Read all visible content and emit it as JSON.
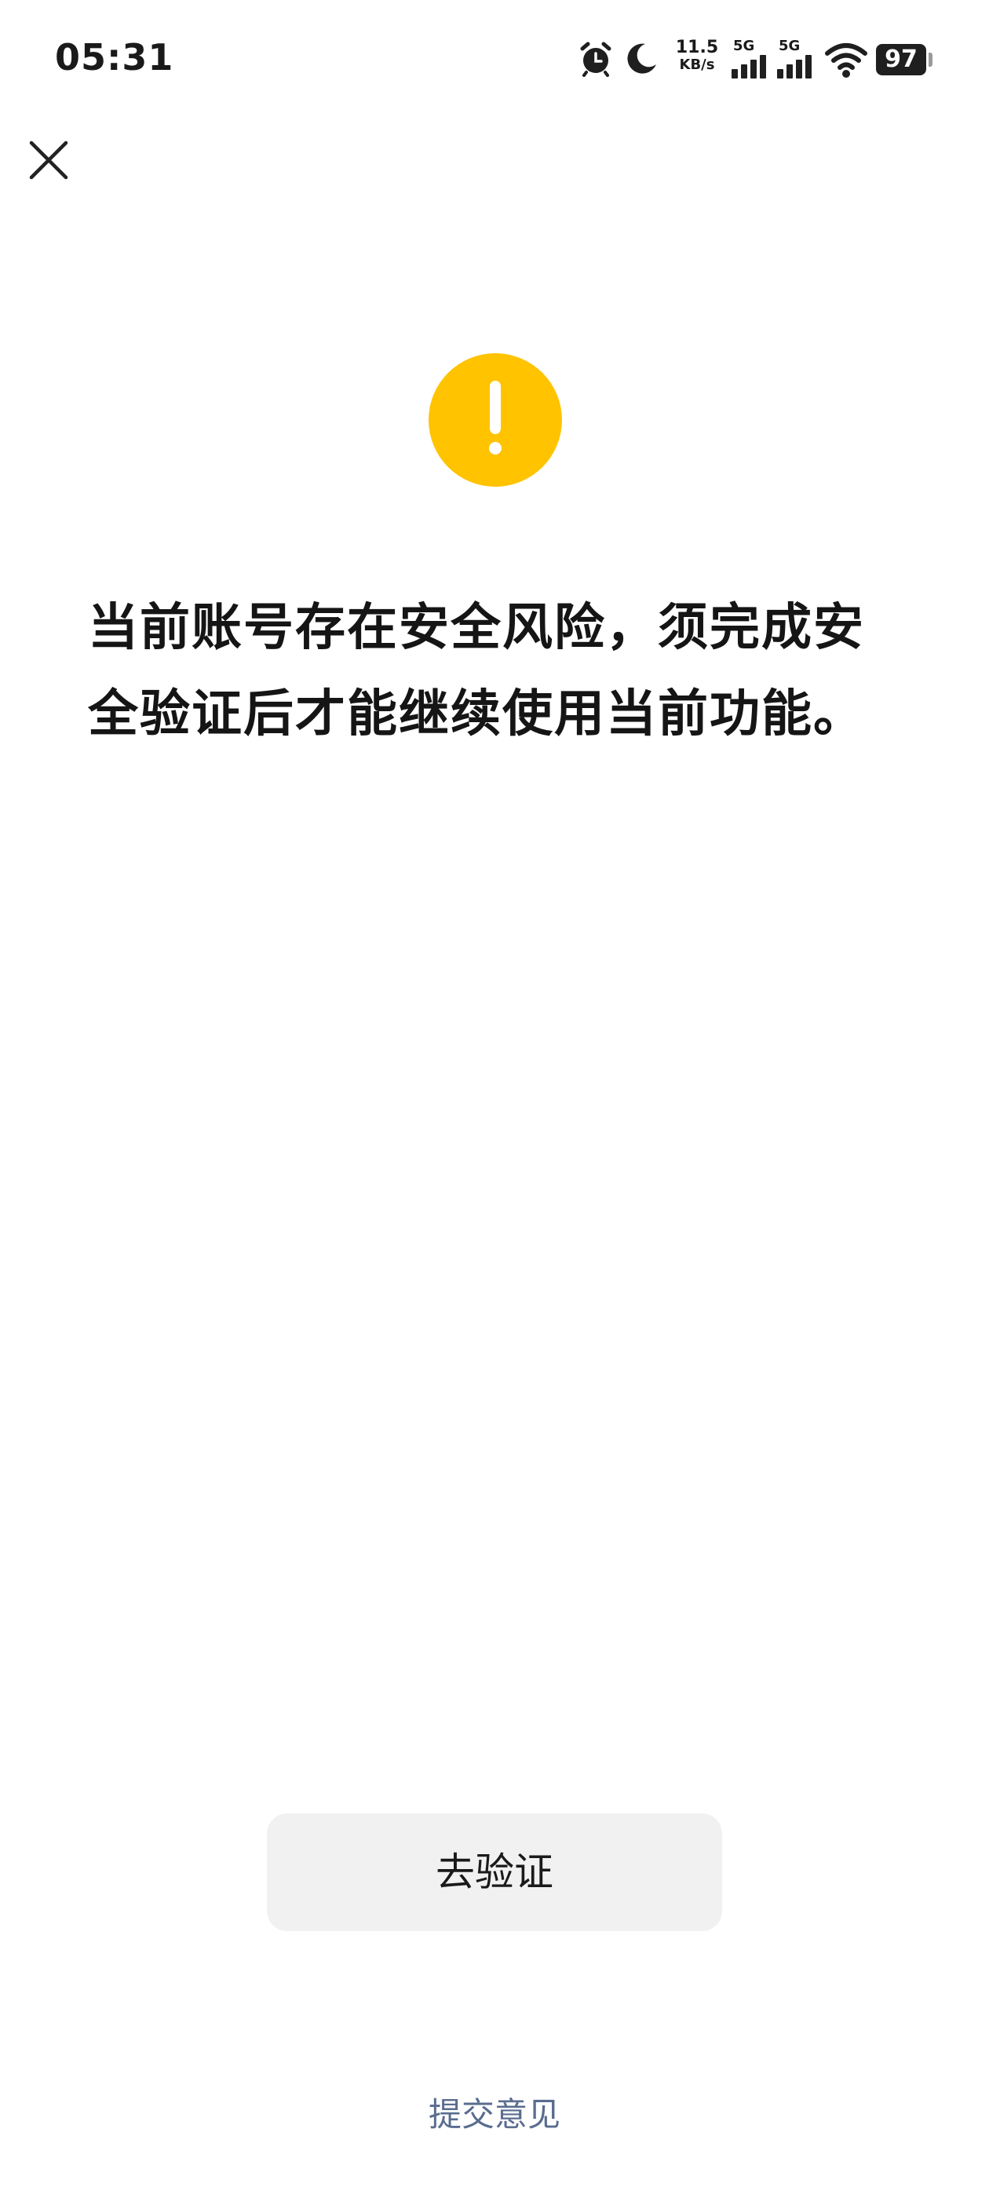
{
  "status_bar": {
    "time": "05:31",
    "net_speed_value": "11.5",
    "net_speed_unit": "KB/s",
    "sim1_label": "5G",
    "sim2_label": "5G",
    "battery_level": "97",
    "icons": [
      "alarm-icon",
      "moon-icon",
      "signal-icon",
      "signal-icon",
      "wifi-icon",
      "battery-icon"
    ]
  },
  "header": {
    "close_icon": "close-icon"
  },
  "warning": {
    "icon": "exclamation-icon",
    "color": "#ffc300",
    "message_line1": "当前账号存在安全风险，须完成安",
    "message_line2": "全验证后才能继续使用当前功能。"
  },
  "actions": {
    "verify_label": "去验证",
    "feedback_label": "提交意见"
  }
}
